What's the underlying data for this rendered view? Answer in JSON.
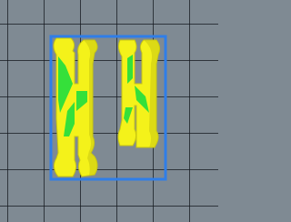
{
  "scene": {
    "type": "3d-print-build-plate-view",
    "plate_color": "#7f8a93",
    "grid_color": "#1a1f26",
    "selection_color": "#2f7ee8"
  },
  "objects": [
    {
      "id": "part-left",
      "shape": "H-shaped connector",
      "selected": true,
      "body_color": "#f4f21a",
      "overhang_color": "#35e03a",
      "edge_color": "#c9c712"
    },
    {
      "id": "part-right",
      "shape": "H-shaped connector",
      "selected": true,
      "body_color": "#f4f21a",
      "overhang_color": "#35e03a",
      "edge_color": "#c9c712"
    }
  ]
}
